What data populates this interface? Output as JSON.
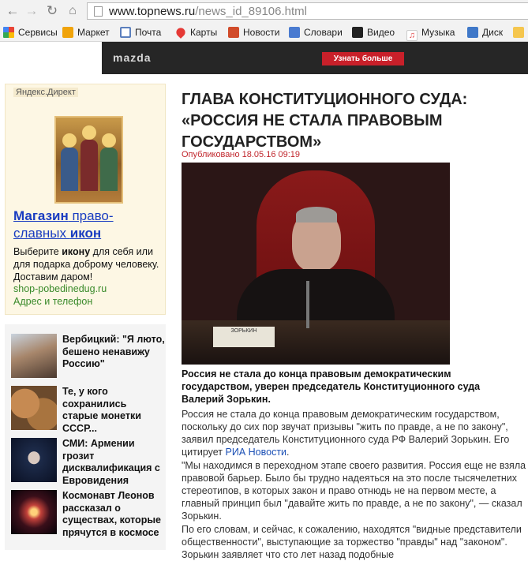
{
  "browser": {
    "url_host": "www.topnews.ru",
    "url_path": "/news_id_89106.html"
  },
  "bookmarks": [
    {
      "label": "Сервисы",
      "icon": "apps-grid-icon",
      "color": "#e94335"
    },
    {
      "label": "Маркет",
      "icon": "market-icon",
      "color": "#f0a30a"
    },
    {
      "label": "Почта",
      "icon": "mail-icon",
      "color": "#5b7fbd"
    },
    {
      "label": "Карты",
      "icon": "map-pin-icon",
      "color": "#e53935"
    },
    {
      "label": "Новости",
      "icon": "news-icon",
      "color": "#d14b2a"
    },
    {
      "label": "Словари",
      "icon": "dictionary-icon",
      "color": "#4a7bd0"
    },
    {
      "label": "Видео",
      "icon": "video-icon",
      "color": "#222222"
    },
    {
      "label": "Музыка",
      "icon": "music-icon",
      "color": "#e24b4b"
    },
    {
      "label": "Диск",
      "icon": "disk-icon",
      "color": "#3f78c8"
    }
  ],
  "banner": {
    "brand": "mazda",
    "cta": "Узнать больше"
  },
  "ad": {
    "label": "Яндекс.Директ",
    "title_b1": "Магазин",
    "title_t1": " право-",
    "title_t2": "славных ",
    "title_b2": "икон",
    "desc_1": "Выберите ",
    "desc_b": "икону",
    "desc_2": " для себя или для подарка доброму человеку. Доставим даром!",
    "domain": "shop-pobedinedug.ru",
    "contact": "Адрес и телефон"
  },
  "news": [
    {
      "text": "Вербицкий: \"Я люто, бешено ненавижу Россию\""
    },
    {
      "text": "Те, у кого сохранились старые монетки СССР..."
    },
    {
      "text": "СМИ: Армении грозит дисквалификация с Евровидения"
    },
    {
      "text": "Космонавт Леонов рассказал о существах, которые прячутся в космосе"
    }
  ],
  "article": {
    "headline": "ГЛАВА КОНСТИТУЦИОННОГО СУДА: «РОССИЯ НЕ СТАЛА ПРАВОВЫМ ГОСУДАРСТВОМ»",
    "published": "Опубликовано 18.05.16 09:19",
    "nameplate": "ЗОРЬКИН",
    "lead": "Россия не стала до конца правовым демократическим государством, уверен председатель Конституционного суда Валерий Зорькин.",
    "p1": "Россия не стала до конца правовым демократическим государством, поскольку до сих пор звучат призывы \"жить по правде, а не по закону\", заявил председатель Конституционного суда РФ Валерий Зорькин. Его цитирует ",
    "p1_link": "РИА Новости",
    "p1_end": ".",
    "p2": "\"Мы находимся в переходном этапе своего развития. Россия еще не взяла правовой барьер. Было бы трудно надеяться на это после тысячелетних стереотипов, в которых закон и право отнюдь не на первом месте, а главный принцип был \"давайте жить по правде, а не по закону\", — сказал Зорькин.",
    "p3": "По его словам, и сейчас, к сожалению, находятся \"видные представители общественности\", выступающие за торжество \"правды\" над \"законом\". Зорькин заявляет что сто лет назад подобные"
  }
}
